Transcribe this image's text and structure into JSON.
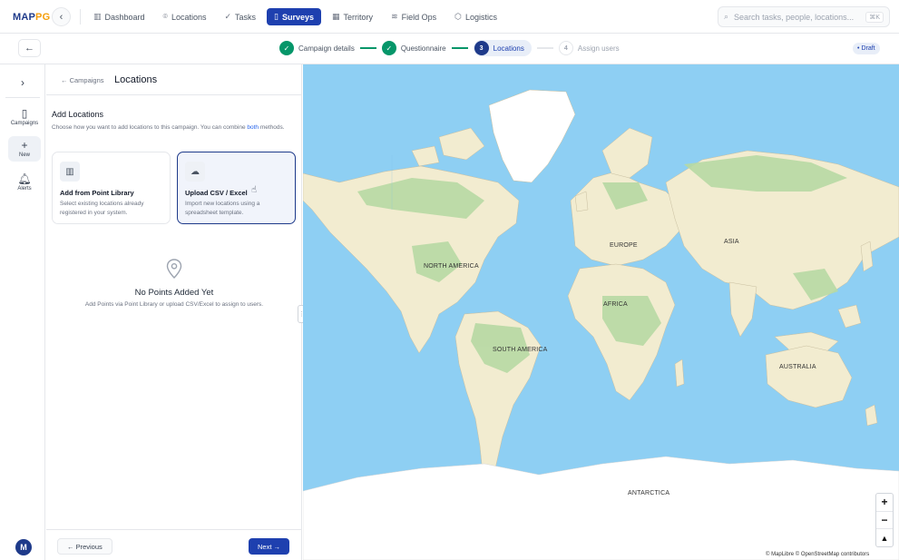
{
  "app": {
    "logo_main": "MAP",
    "logo_accent": "PG"
  },
  "nav": {
    "items": [
      {
        "label": "Dashboard",
        "icon": "bar-chart-icon"
      },
      {
        "label": "Locations",
        "icon": "map-pin-icon"
      },
      {
        "label": "Tasks",
        "icon": "check-list-icon"
      },
      {
        "label": "Surveys",
        "icon": "clipboard-icon"
      },
      {
        "label": "Territory",
        "icon": "map-icon"
      },
      {
        "label": "Field Ops",
        "icon": "route-icon"
      },
      {
        "label": "Logistics",
        "icon": "box-icon"
      }
    ],
    "active": "Surveys"
  },
  "search": {
    "placeholder": "Search tasks, people, locations...",
    "shortcut": "⌘K"
  },
  "stepper": {
    "steps": [
      {
        "number": "1",
        "label": "Campaign details",
        "status": "done"
      },
      {
        "number": "2",
        "label": "Questionnaire",
        "status": "done"
      },
      {
        "number": "3",
        "label": "Locations",
        "status": "current"
      },
      {
        "number": "4",
        "label": "Assign users",
        "status": "todo"
      }
    ],
    "badge": "Draft"
  },
  "rail": {
    "items": [
      {
        "label": "Campaigns",
        "icon": "clipboard-icon"
      },
      {
        "label": "New",
        "icon": "plus-icon"
      },
      {
        "label": "Alerts",
        "icon": "bell-icon"
      }
    ],
    "avatar": "M"
  },
  "panel": {
    "breadcrumb_back": "← Campaigns",
    "title": "Locations",
    "section_title": "Add Locations",
    "section_desc_prefix": "Choose how you want to add locations to this campaign. You can combine ",
    "section_desc_link": "both",
    "section_desc_suffix": " methods.",
    "cards": [
      {
        "title": "Add from Point Library",
        "desc": "Select existing locations already registered in your system.",
        "icon": "library-icon"
      },
      {
        "title": "Upload CSV / Excel",
        "desc": "Import new locations using a spreadsheet template.",
        "icon": "cloud-upload-icon"
      }
    ],
    "empty_title": "No Points Added Yet",
    "empty_desc": "Add Points via Point Library or upload CSV/Excel to assign to users.",
    "prev_label": "← Previous",
    "next_label": "Next →"
  },
  "map": {
    "labels": [
      "NORTH AMERICA",
      "SOUTH AMERICA",
      "EUROPE",
      "AFRICA",
      "ASIA",
      "AUSTRALIA",
      "ANTARCTICA"
    ],
    "attribution": "© MapLibre © OpenStreetMap contributors",
    "zoom_in": "+",
    "zoom_out": "−",
    "compass": "▲",
    "colors": {
      "water": "#8ecff3",
      "land": "#f2ecd0",
      "forest": "#b7d9a3",
      "ice": "#ffffff"
    }
  }
}
